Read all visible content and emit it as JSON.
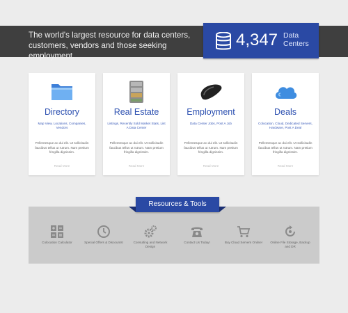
{
  "header": {
    "tagline": "The world's largest resource for data centers, customers, vendors and those seeking employment.",
    "count": "4,347",
    "count_label": "Data Centers",
    "accent": "#2a49a4",
    "icon": "database-icon"
  },
  "cards": [
    {
      "title": "Directory",
      "icon": "folder-icon",
      "sub": "Map View, Locations, Companies, Vendors",
      "body": "Pellentesque ac dui elit. Ut sollicitudin faucibus tellus ut rutrum. Nam pretium fringilla dignissim.",
      "more": "Read More"
    },
    {
      "title": "Real Estate",
      "icon": "server-icon",
      "sub": "Listings, Recently Sold Market Stats, List A Data Center",
      "body": "Pellentesque ac dui elit. Ut sollicitudin faucibus tellus ut rutrum. Nam pretium fringilla dignissim.",
      "more": "Read More"
    },
    {
      "title": "Employment",
      "icon": "mouse-icon",
      "sub": "Data Center Jobs, Post A Job",
      "body": "Pellentesque ac dui elit. Ut sollicitudin faucibus tellus ut rutrum. Nam pretium fringilla dignissim.",
      "more": "Read More"
    },
    {
      "title": "Deals",
      "icon": "cloud-icon",
      "sub": "Colocation, Cloud, Dedicated Servers, Hardware, Post A Deal",
      "body": "Pellentesque ac dui elit. Ut sollicitudin faucibus tellus ut rutrum. Nam pretium fringilla dignissim.",
      "more": "Read More"
    }
  ],
  "resources": {
    "title": "Resources & Tools",
    "tools": [
      {
        "label": "Colocation Calculator",
        "icon": "calculator-icon"
      },
      {
        "label": "Special Offers & Discounts!",
        "icon": "clock-icon"
      },
      {
        "label": "Consulting and Network Design",
        "icon": "gears-icon"
      },
      {
        "label": "Contact Us Today!",
        "icon": "phone-icon"
      },
      {
        "label": "Buy Cloud Servers Online!",
        "icon": "cart-icon"
      },
      {
        "label": "Online File Storage, Backup and DR",
        "icon": "backup-icon"
      }
    ]
  }
}
